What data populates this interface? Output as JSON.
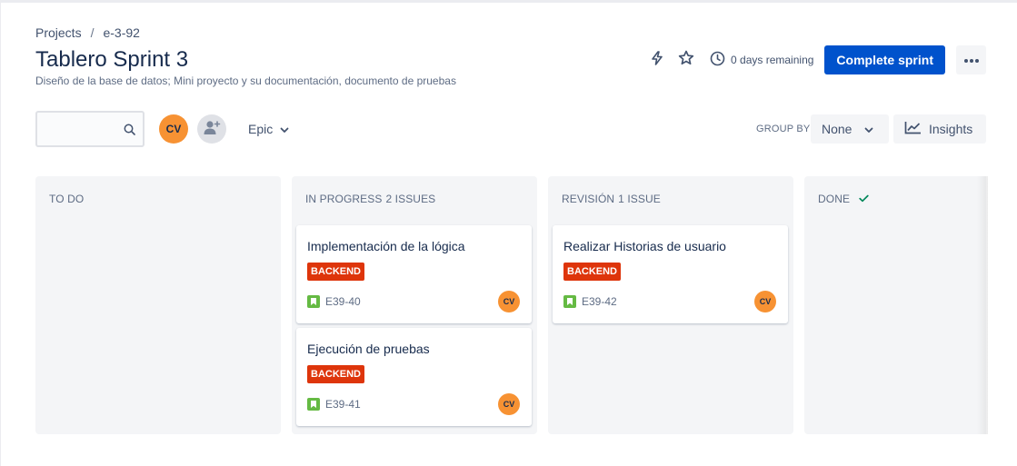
{
  "breadcrumb": {
    "projects": "Projects",
    "separator": "/",
    "project_key": "e-3-92"
  },
  "header": {
    "title": "Tablero Sprint 3",
    "subtitle": "Diseño de la base de datos; Mini proyecto y su documentación, documento de pruebas",
    "remaining": "0 days remaining",
    "complete_label": "Complete sprint",
    "icons": [
      "automation-icon",
      "star-icon",
      "clock-icon",
      "more-icon"
    ]
  },
  "toolbar": {
    "search_placeholder": "",
    "avatar_initials": "CV",
    "epic_label": "Epic",
    "groupby_label": "GROUP BY",
    "groupby_value": "None",
    "insights_label": "Insights"
  },
  "columns": [
    {
      "title": "TO DO",
      "count": "",
      "cards": []
    },
    {
      "title": "IN PROGRESS",
      "count": "2 ISSUES",
      "cards": [
        {
          "title": "Implementación de la lógica",
          "label": "BACKEND",
          "key": "E39-40",
          "assignee": "CV"
        },
        {
          "title": "Ejecución de pruebas",
          "label": "BACKEND",
          "key": "E39-41",
          "assignee": "CV"
        }
      ]
    },
    {
      "title": "REVISIÓN",
      "count": "1 ISSUE",
      "cards": [
        {
          "title": "Realizar Historias de usuario",
          "label": "BACKEND",
          "key": "E39-42",
          "assignee": "CV"
        }
      ]
    },
    {
      "title": "DONE",
      "count": "",
      "cards": []
    }
  ],
  "colors": {
    "primary": "#0052cc",
    "label_backend": "#de350b",
    "avatar": "#f79233",
    "story": "#65ba43",
    "done_check": "#00875a"
  }
}
